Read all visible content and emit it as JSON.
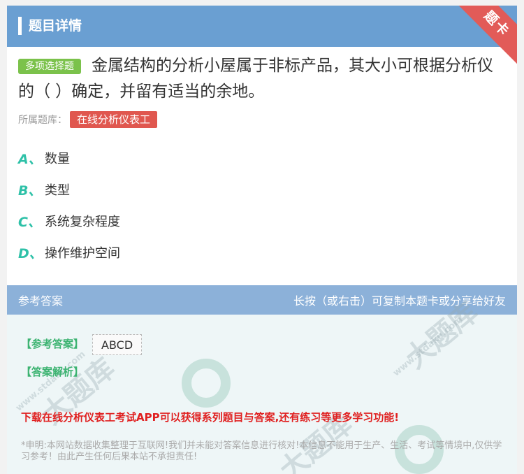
{
  "header": {
    "title": "题目详情",
    "ribbon": "题卡"
  },
  "question": {
    "type": "多项选择题",
    "text": "金属结构的分析小屋属于非标产品，其大小可根据分析仪的（ ）确定，并留有适当的余地。",
    "bank_label": "所属题库：",
    "bank_value": "在线分析仪表工"
  },
  "options": [
    {
      "letter": "A、",
      "text": "数量"
    },
    {
      "letter": "B、",
      "text": "类型"
    },
    {
      "letter": "C、",
      "text": "系统复杂程度"
    },
    {
      "letter": "D、",
      "text": "操作维护空间"
    }
  ],
  "answer": {
    "head_left": "参考答案",
    "head_right": "长按（或右击）可复制本题卡或分享给好友",
    "ref_label": "【参考答案】",
    "ref_value": "ABCD",
    "analysis_label": "【答案解析】",
    "promo": "下载在线分析仪表工考试APP可以获得系列题目与答案,还有练习等更多学习功能!",
    "disclaimer": "*申明:本网站数据收集整理于互联网!我们并未能对答案信息进行核对!本信息不能用于生产、生活、考试等情境中,仅供学习参考！由此产生任何后果本站不承担责任!"
  },
  "watermark": {
    "text": "大题库",
    "url": "www.stdaku.com"
  }
}
